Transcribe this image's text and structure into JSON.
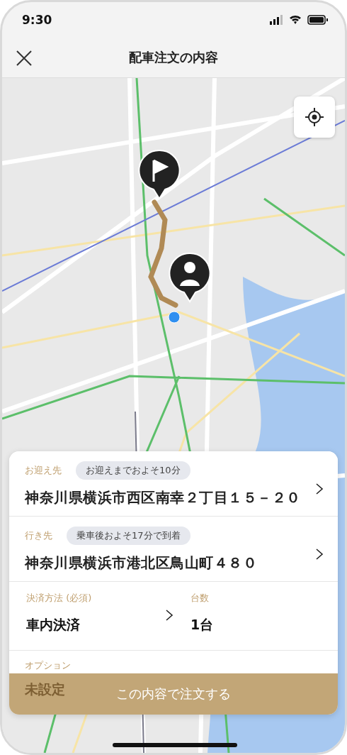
{
  "status_bar": {
    "time": "9:30"
  },
  "header": {
    "title": "配車注文の内容"
  },
  "pickup": {
    "label": "お迎え先",
    "badge": "お迎えまでおよそ10分",
    "address": "神奈川県横浜市西区南幸２丁目１５－２０"
  },
  "destination": {
    "label": "行き先",
    "badge": "乗車後およそ17分で到着",
    "address": "神奈川県横浜市港北区鳥山町４８０"
  },
  "payment": {
    "label": "決済方法 (必須)",
    "value": "車内決済"
  },
  "count": {
    "label": "台数",
    "value": "1台"
  },
  "option": {
    "label": "オプション",
    "value": "未設定"
  },
  "order_button": "この内容で注文する"
}
